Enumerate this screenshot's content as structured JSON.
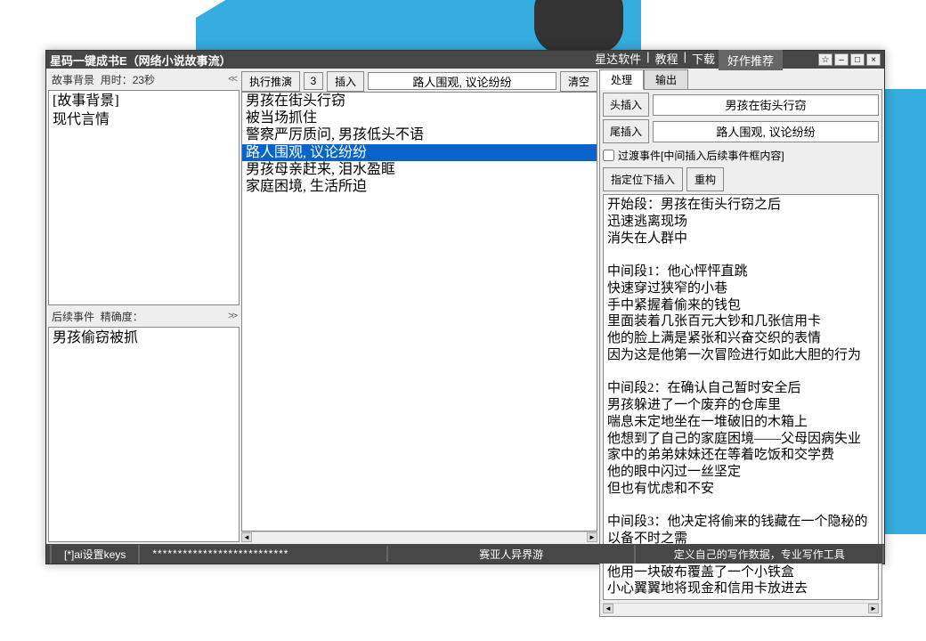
{
  "window": {
    "title": "星码一键成书E（网络小说故事流）",
    "links": [
      "星达软件",
      "教程",
      "下载"
    ],
    "recommend": "好作推荐"
  },
  "left": {
    "bg_header": "故事背景",
    "bg_timer": "用时：23秒",
    "bg_text": "[故事背景]\n现代言情",
    "follow_header": "后续事件",
    "follow_acc": "精确度：",
    "follow_text": "男孩偷窃被抓"
  },
  "mid": {
    "exec_btn": "执行推演",
    "exec_count": "3",
    "insert_btn": "插入",
    "input_value": "路人围观, 议论纷纷",
    "clear_btn": "清空",
    "list": [
      "男孩在街头行窃",
      "被当场抓住",
      "警察严厉质问, 男孩低头不语",
      "路人围观, 议论纷纷",
      "男孩母亲赶来, 泪水盈眶",
      "家庭困境, 生活所迫"
    ],
    "selected_index": 3
  },
  "right": {
    "tabs": [
      "处理",
      "输出"
    ],
    "head_insert_btn": "头插入",
    "head_insert_value": "男孩在街头行窃",
    "tail_insert_btn": "尾插入",
    "tail_insert_value": "路人围观, 议论纷纷",
    "checkbox_label": "过渡事件[中间插入后续事件框内容]",
    "locate_btn": "指定位下插入",
    "rebuild_btn": "重构",
    "output": "开始段：男孩在街头行窃之后\n迅速逃离现场\n消失在人群中\n\n中间段1：他心怦怦直跳\n快速穿过狭窄的小巷\n手中紧握着偷来的钱包\n里面装着几张百元大钞和几张信用卡\n他的脸上满是紧张和兴奋交织的表情\n因为这是他第一次冒险进行如此大胆的行为\n\n中间段2：在确认自己暂时安全后\n男孩躲进了一个废弃的仓库里\n喘息未定地坐在一堆破旧的木箱上\n他想到了自己的家庭困境——父母因病失业\n家中的弟弟妹妹还在等着吃饭和交学费\n他的眼中闪过一丝坚定\n但也有忧虑和不安\n\n中间段3：他决定将偷来的钱藏在一个隐秘的\n以备不时之需\n在仓库的角落里\n他用一块破布覆盖了一个小铁盒\n小心翼翼地将现金和信用卡放进去"
  },
  "bottom": {
    "keys": "[*]ai设置keys",
    "stars": "***************************",
    "mid": "赛亚人异界游",
    "right": "定义自己的写作数据，专业写作工具"
  }
}
